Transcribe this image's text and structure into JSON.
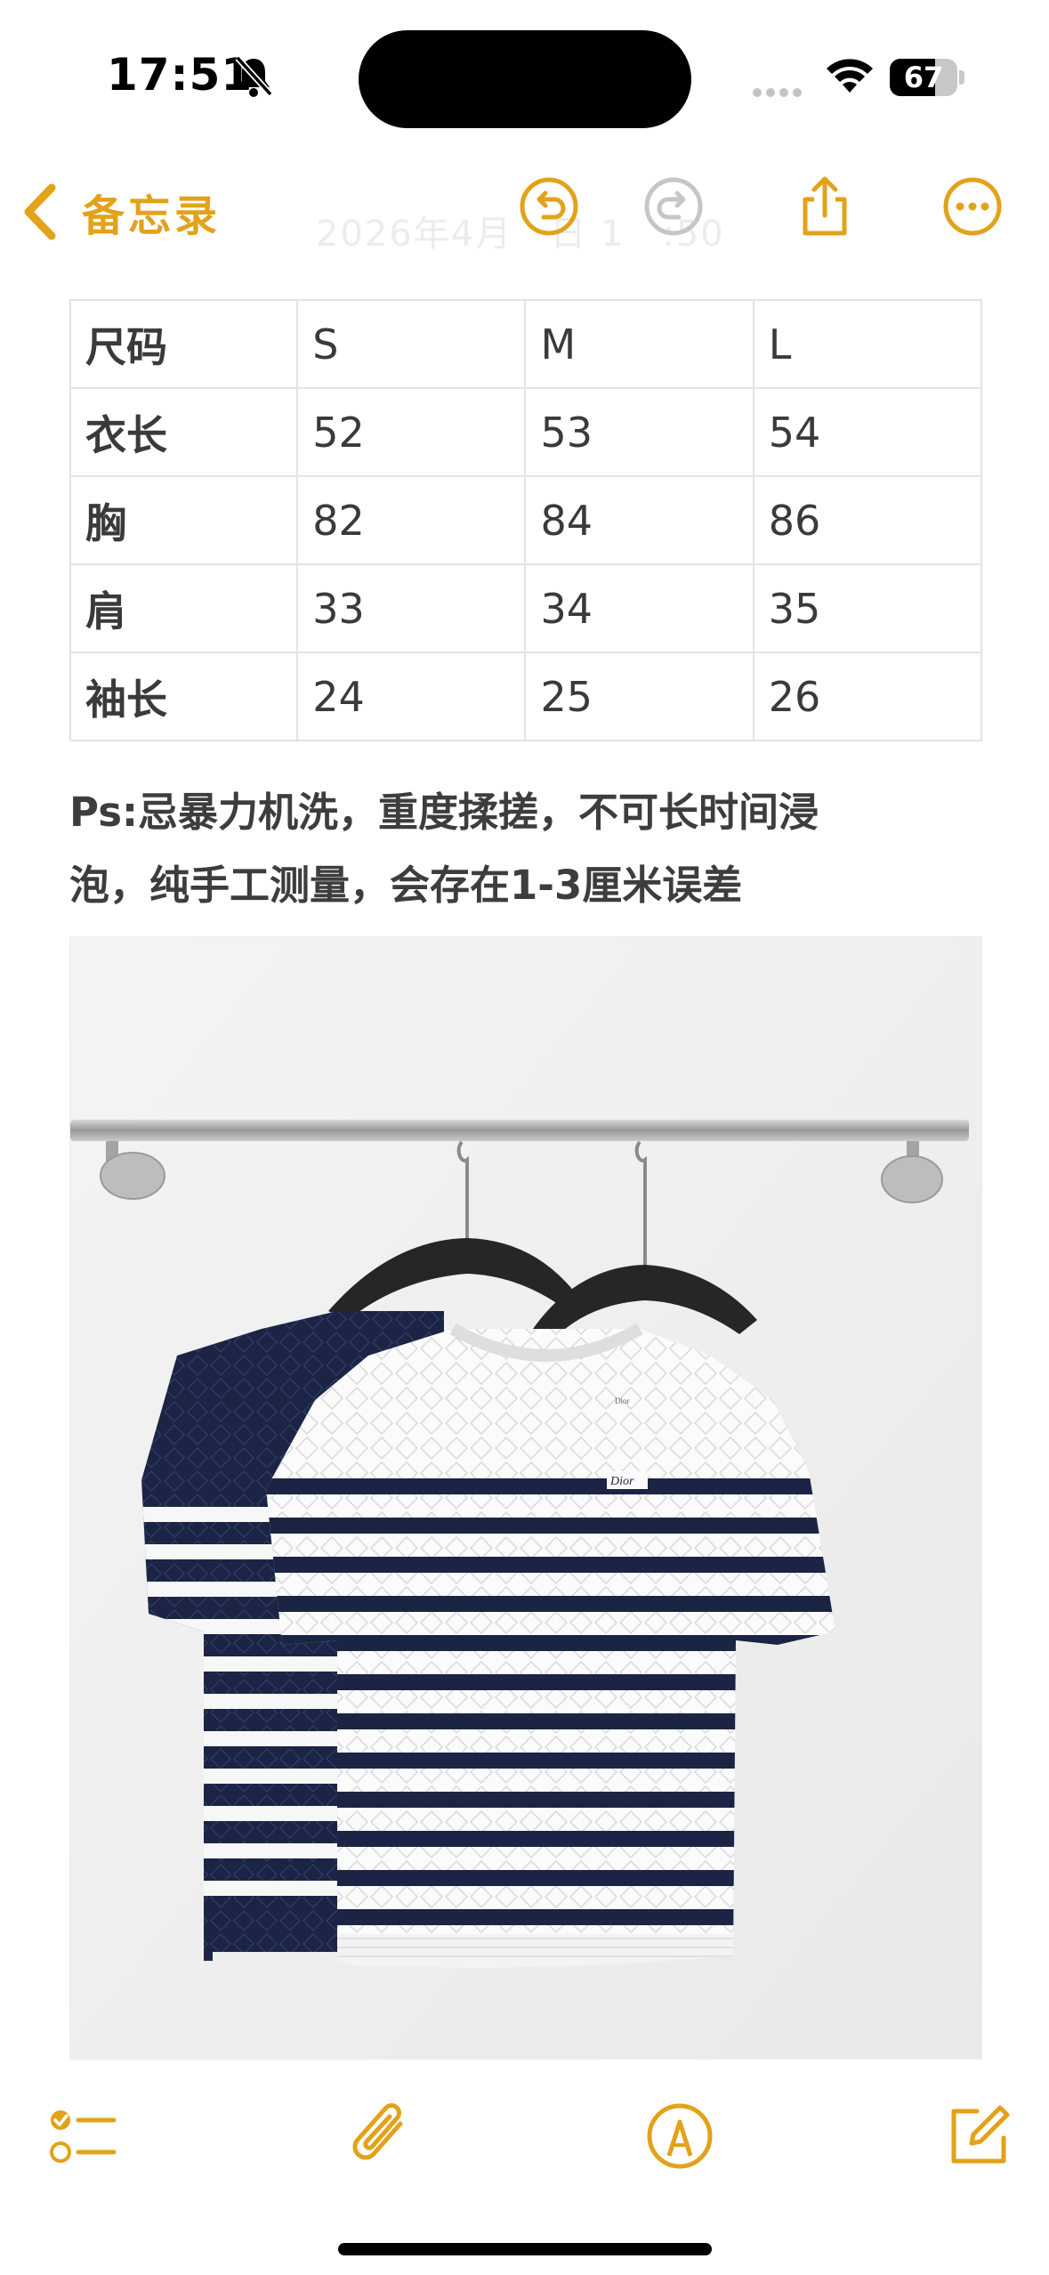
{
  "status": {
    "time": "17:51",
    "battery": "67",
    "battery_level": 0.67
  },
  "nav": {
    "back_label": "备忘录",
    "date_faded": "2026年4月　日 1　:50"
  },
  "table": {
    "rows": [
      {
        "label": "尺码",
        "s": "S",
        "m": "M",
        "l": "L"
      },
      {
        "label": "衣长",
        "s": "52",
        "m": "53",
        "l": "54"
      },
      {
        "label": "胸",
        "s": "82",
        "m": "84",
        "l": "86"
      },
      {
        "label": "肩",
        "s": "33",
        "m": "34",
        "l": "35"
      },
      {
        "label": "袖长",
        "s": "24",
        "m": "25",
        "l": "26"
      }
    ]
  },
  "note": {
    "line1": "Ps:忌暴力机洗，重度揉搓，不可长时间浸",
    "line2": "泡，纯手工测量，会存在1-3厘米误差"
  },
  "photo": {
    "brand_mark": "Dior"
  },
  "colors": {
    "accent": "#e2a21a",
    "navy": "#1b2444"
  }
}
